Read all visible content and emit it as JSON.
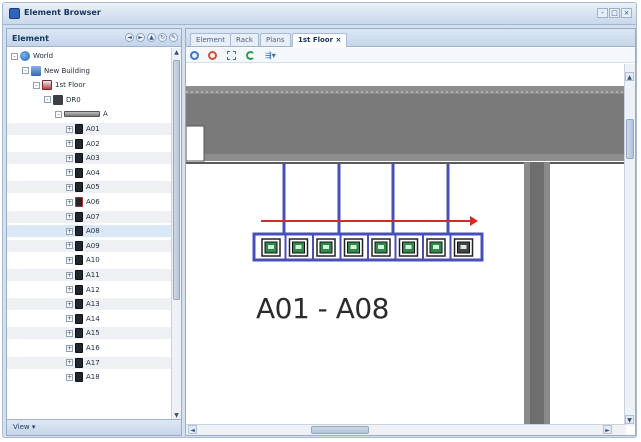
{
  "window": {
    "title": "Element Browser",
    "buttons": [
      "-",
      "□",
      "×"
    ]
  },
  "left_panel": {
    "title": "Element",
    "nav_buttons": [
      "◄",
      "►",
      "▲",
      "↻",
      "✎"
    ],
    "footer": "View ▾",
    "tree": [
      {
        "label": "World",
        "icon": "globe-icon",
        "depth": 0,
        "expander": "-"
      },
      {
        "label": "New Building",
        "icon": "building-icon",
        "depth": 1,
        "expander": "-"
      },
      {
        "label": "1st Floor",
        "icon": "floor-icon",
        "depth": 2,
        "expander": "-"
      },
      {
        "label": "DR0",
        "icon": "data-room-icon",
        "depth": 3,
        "expander": "-"
      },
      {
        "label": "A",
        "icon": "rack-row-icon",
        "depth": 4,
        "expander": "-"
      },
      {
        "label": "A01",
        "icon": "rack-icon",
        "depth": 5,
        "expander": "+"
      },
      {
        "label": "A02",
        "icon": "rack-icon",
        "depth": 5,
        "expander": "+"
      },
      {
        "label": "A03",
        "icon": "rack-icon",
        "depth": 5,
        "expander": "+"
      },
      {
        "label": "A04",
        "icon": "rack-icon",
        "depth": 5,
        "expander": "+"
      },
      {
        "label": "A05",
        "icon": "rack-icon",
        "depth": 5,
        "expander": "+"
      },
      {
        "label": "A06",
        "icon": "rack-icon-alert",
        "depth": 5,
        "expander": "+"
      },
      {
        "label": "A07",
        "icon": "rack-icon",
        "depth": 5,
        "expander": "+"
      },
      {
        "label": "A08",
        "icon": "rack-icon",
        "depth": 5,
        "expander": "+"
      },
      {
        "label": "A09",
        "icon": "rack-icon",
        "depth": 5,
        "expander": "+"
      },
      {
        "label": "A10",
        "icon": "rack-icon",
        "depth": 5,
        "expander": "+"
      },
      {
        "label": "A11",
        "icon": "rack-icon",
        "depth": 5,
        "expander": "+"
      },
      {
        "label": "A12",
        "icon": "rack-icon",
        "depth": 5,
        "expander": "+"
      },
      {
        "label": "A13",
        "icon": "rack-icon",
        "depth": 5,
        "expander": "+"
      },
      {
        "label": "A14",
        "icon": "rack-icon",
        "depth": 5,
        "expander": "+"
      },
      {
        "label": "A15",
        "icon": "rack-icon",
        "depth": 5,
        "expander": "+"
      },
      {
        "label": "A16",
        "icon": "rack-icon",
        "depth": 5,
        "expander": "+"
      },
      {
        "label": "A17",
        "icon": "rack-icon",
        "depth": 5,
        "expander": "+"
      },
      {
        "label": "A18",
        "icon": "rack-icon",
        "depth": 5,
        "expander": "+"
      }
    ],
    "selected_item": "A08"
  },
  "right_panel": {
    "tabs": [
      {
        "label": "Element",
        "active": false
      },
      {
        "label": "Rack",
        "active": false
      },
      {
        "label": "Plans",
        "active": false
      },
      {
        "label": "1st Floor",
        "active": true,
        "closable": true
      }
    ],
    "toolbar": [
      "zoom-in-icon",
      "zoom-out-icon",
      "fit-icon",
      "refresh-icon",
      "layout-icon"
    ],
    "plan": {
      "row_label": "A01 - A08",
      "rack_count": 8,
      "accent_blue": "#4a4fb8",
      "arrow_red": "#d42a2a",
      "rack_green": "#2e8b4a"
    }
  }
}
